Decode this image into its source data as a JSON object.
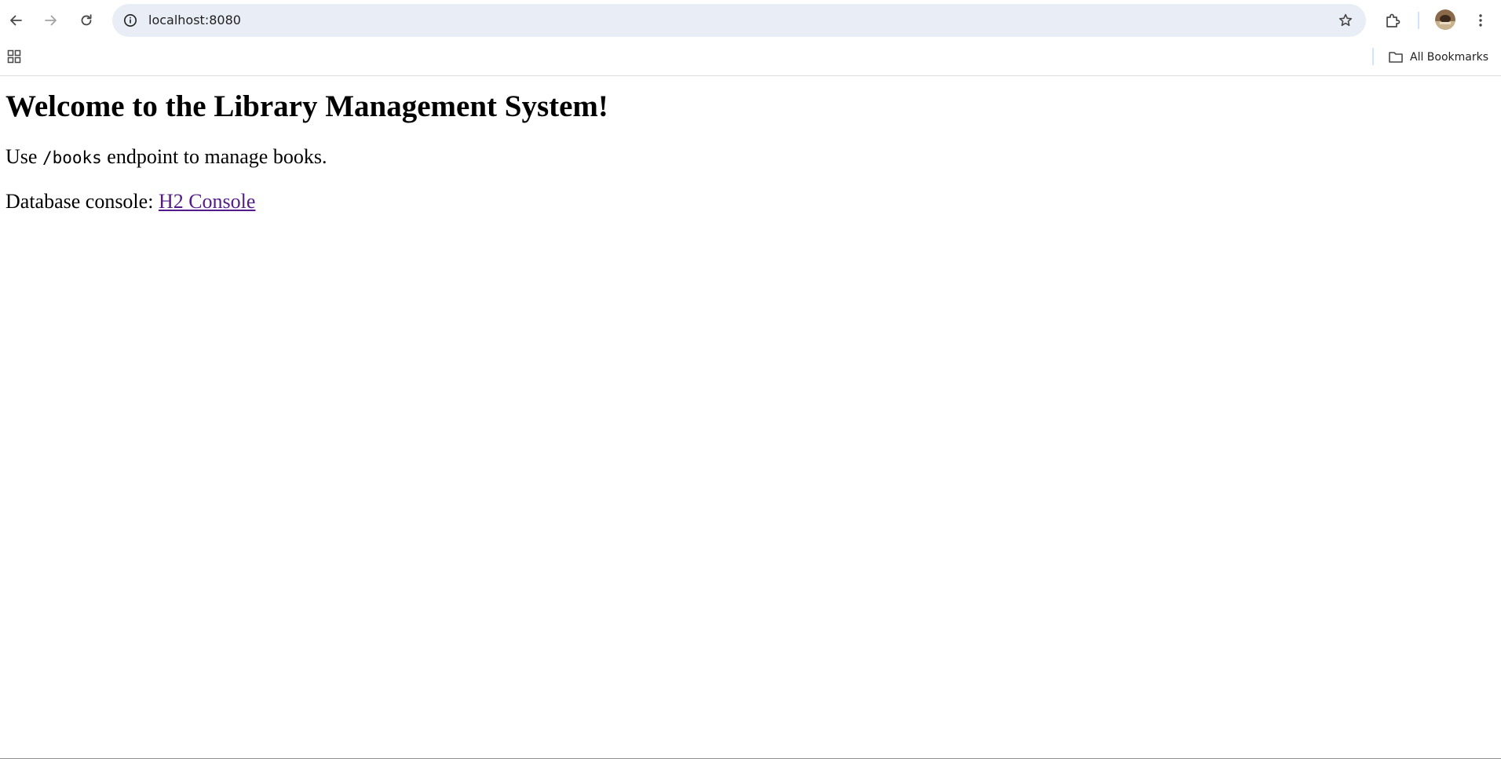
{
  "browser": {
    "url": "localhost:8080",
    "bookmarks": {
      "all_bookmarks_label": "All Bookmarks"
    },
    "icons": {
      "back": "arrow-left-icon",
      "forward": "arrow-right-icon",
      "reload": "reload-icon",
      "site_info": "info-icon",
      "bookmark_star": "star-icon",
      "extensions": "puzzle-icon",
      "profile": "avatar",
      "menu": "kebab-menu-icon",
      "apps": "apps-grid-icon",
      "folder": "folder-icon"
    }
  },
  "page": {
    "title": "Welcome to the Library Management System!",
    "usage": {
      "prefix": "Use ",
      "endpoint": "/books",
      "suffix": " endpoint to manage books."
    },
    "console": {
      "prefix": "Database console: ",
      "link_text": "H2 Console"
    }
  },
  "colors": {
    "omnibox_bg": "#e9eef6",
    "link_visited": "#551a8b",
    "text": "#000000"
  }
}
